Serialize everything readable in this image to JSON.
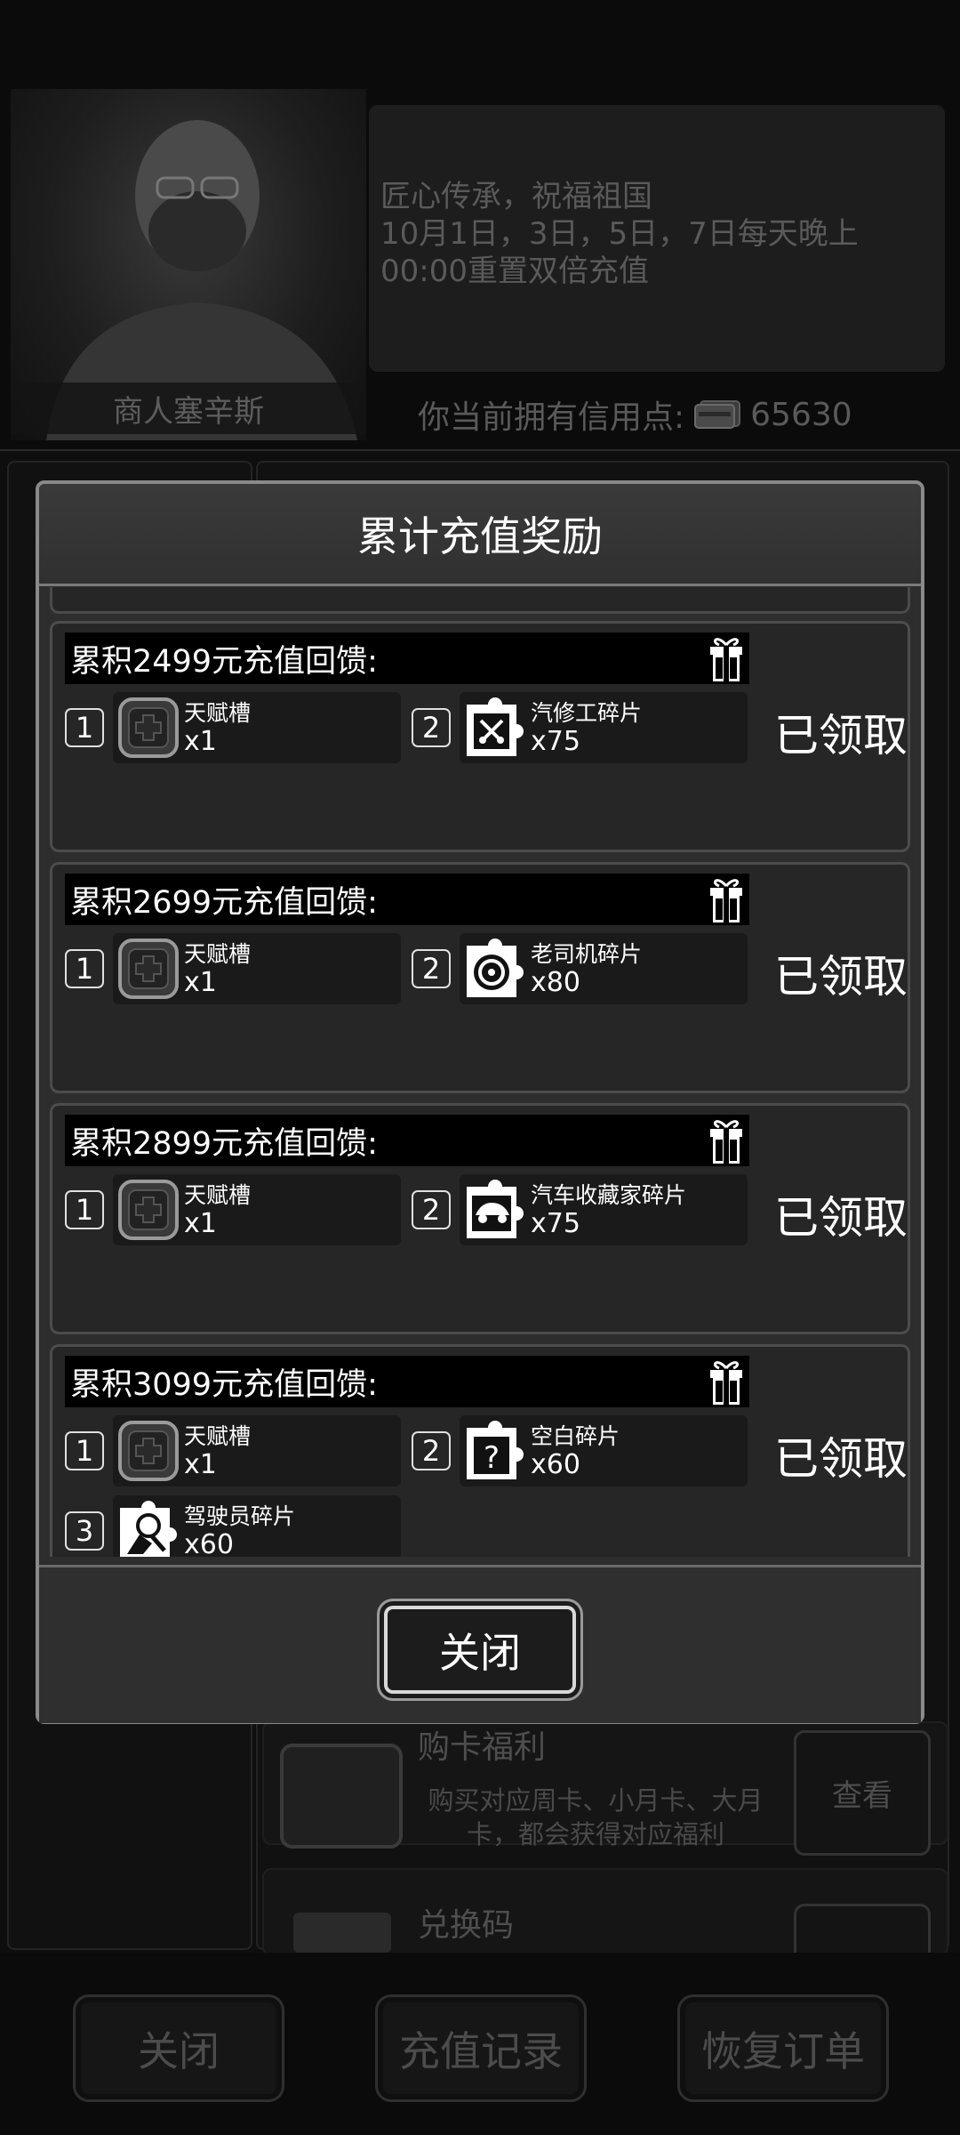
{
  "background": {
    "merchant_name": "商人塞辛斯",
    "announcement": "匠心传承，祝福祖国\n10月1日，3日，5日，7日每天晚上\n00:00重置双倍充值",
    "credit_label": "你当前拥有信用点:",
    "credit_value": "65630",
    "card_title": "购卡福利",
    "card_desc": "购买对应周卡、小月卡、大月卡，都会获得对应福利",
    "card_button": "查看",
    "card2_title": "兑换码",
    "bottom_buttons": [
      "关闭",
      "充值记录",
      "恢复订单"
    ]
  },
  "modal": {
    "title": "累计充值奖励",
    "close_label": "关闭",
    "tiers": [
      {
        "title": "累积2499元充值回馈:",
        "status": "已领取",
        "rewards": [
          {
            "index": "1",
            "name": "天赋槽",
            "qty": "x1",
            "icon": "talent-slot-icon"
          },
          {
            "index": "2",
            "name": "汽修工碎片",
            "qty": "x75",
            "icon": "mechanic-fragment-icon"
          }
        ]
      },
      {
        "title": "累积2699元充值回馈:",
        "status": "已领取",
        "rewards": [
          {
            "index": "1",
            "name": "天赋槽",
            "qty": "x1",
            "icon": "talent-slot-icon"
          },
          {
            "index": "2",
            "name": "老司机碎片",
            "qty": "x80",
            "icon": "veteran-driver-fragment-icon"
          }
        ]
      },
      {
        "title": "累积2899元充值回馈:",
        "status": "已领取",
        "rewards": [
          {
            "index": "1",
            "name": "天赋槽",
            "qty": "x1",
            "icon": "talent-slot-icon"
          },
          {
            "index": "2",
            "name": "汽车收藏家碎片",
            "qty": "x75",
            "icon": "car-collector-fragment-icon"
          }
        ]
      },
      {
        "title": "累积3099元充值回馈:",
        "status": "已领取",
        "rewards": [
          {
            "index": "1",
            "name": "天赋槽",
            "qty": "x1",
            "icon": "talent-slot-icon"
          },
          {
            "index": "2",
            "name": "空白碎片",
            "qty": "x60",
            "icon": "blank-fragment-icon"
          },
          {
            "index": "3",
            "name": "驾驶员碎片",
            "qty": "x60",
            "icon": "driver-fragment-icon"
          }
        ]
      }
    ]
  }
}
